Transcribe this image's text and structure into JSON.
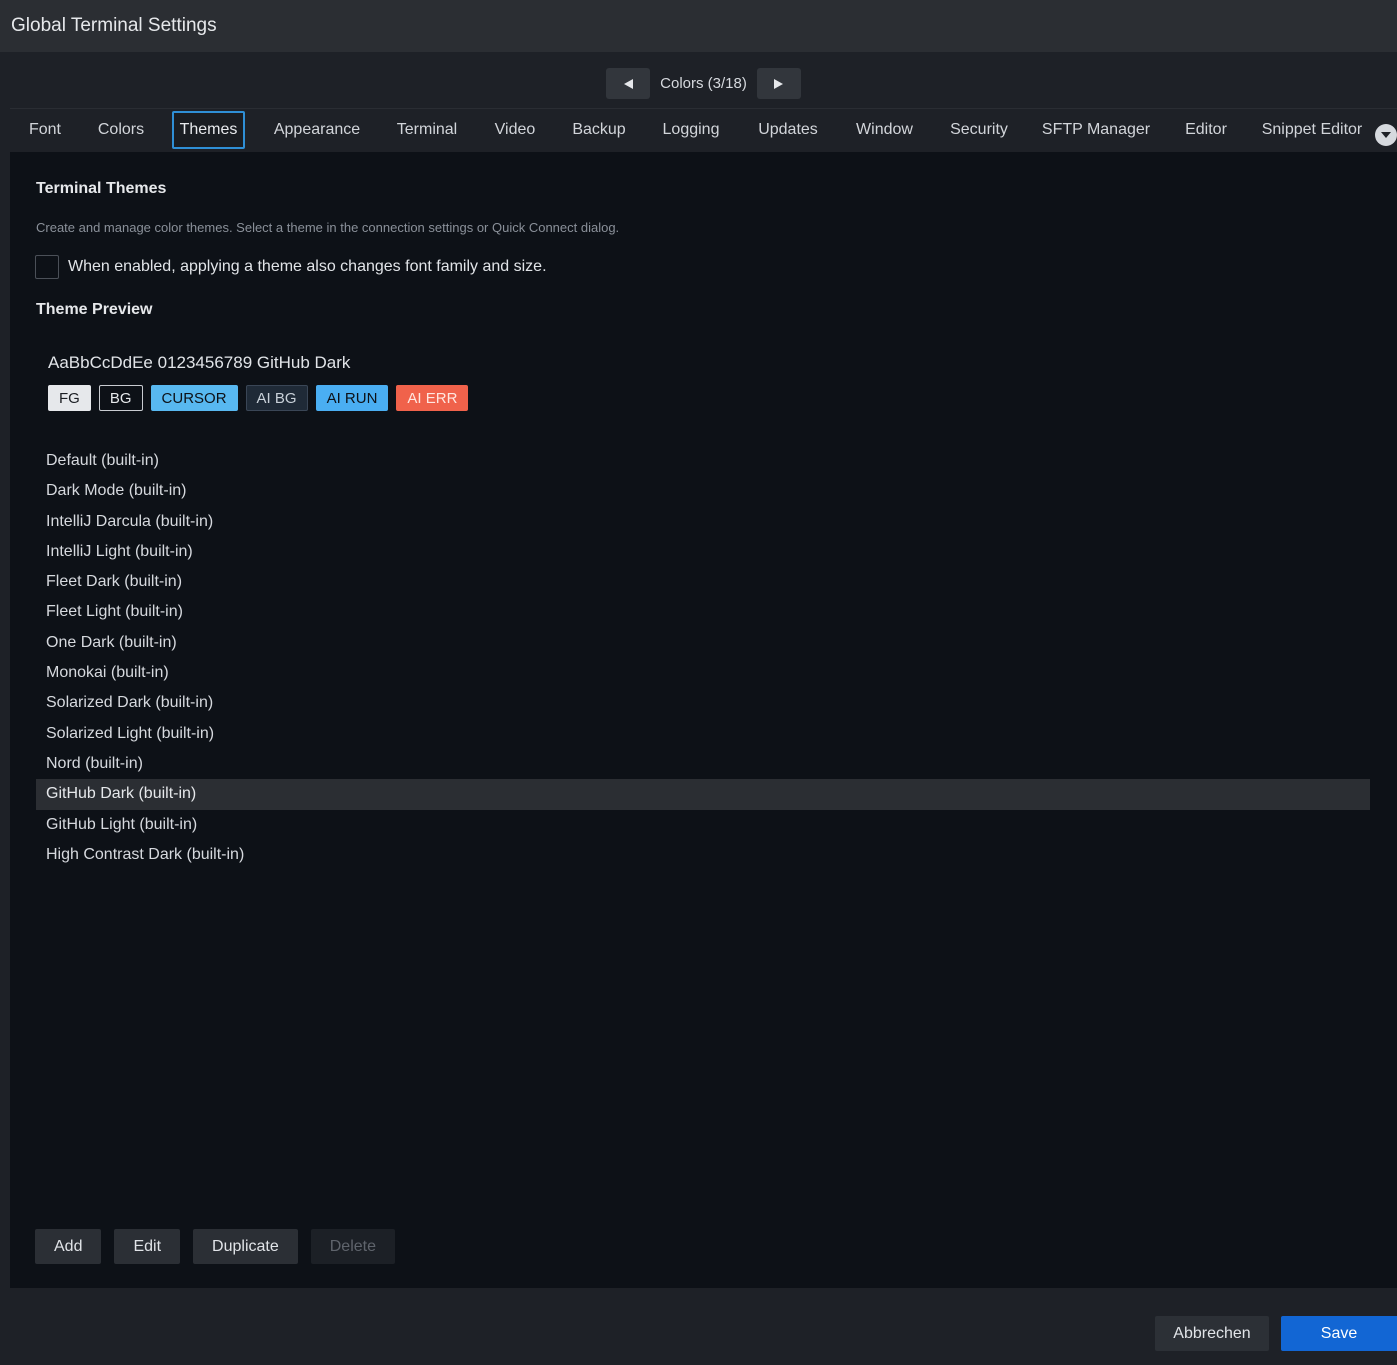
{
  "window": {
    "title": "Global Terminal Settings"
  },
  "pager": {
    "label": "Colors  (3/18)",
    "prev_icon": "triangle-left-icon",
    "next_icon": "triangle-right-icon"
  },
  "tabs": [
    {
      "label": "Font"
    },
    {
      "label": "Colors"
    },
    {
      "label": "Themes",
      "active": true
    },
    {
      "label": "Appearance"
    },
    {
      "label": "Terminal"
    },
    {
      "label": "Video"
    },
    {
      "label": "Backup"
    },
    {
      "label": "Logging"
    },
    {
      "label": "Updates"
    },
    {
      "label": "Window"
    },
    {
      "label": "Security"
    },
    {
      "label": "SFTP Manager"
    },
    {
      "label": "Editor"
    },
    {
      "label": "Snippet Editor"
    }
  ],
  "themes_page": {
    "title": "Terminal Themes",
    "description": "Create and manage color themes. Select a theme in the connection settings or Quick Connect dialog.",
    "font_checkbox": {
      "label": "When enabled, applying a theme also changes font family and size.",
      "checked": false
    },
    "preview": {
      "title": "Theme Preview",
      "sample_text": "AaBbCcDdEe 0123456789  GitHub Dark",
      "chips": [
        {
          "label": "FG",
          "bg": "#e6e8eb",
          "fg": "#1b1e23",
          "border": "#e6e8eb"
        },
        {
          "label": "BG",
          "bg": "#0d1117",
          "fg": "#e6e8eb",
          "border": "#c9ccd1"
        },
        {
          "label": "CURSOR",
          "bg": "#58b8f0",
          "fg": "#0d1117",
          "border": "#58b8f0"
        },
        {
          "label": "AI BG",
          "bg": "#1f2a37",
          "fg": "#c9d1d9",
          "border": "#3a4656"
        },
        {
          "label": "AI RUN",
          "bg": "#4aaef2",
          "fg": "#0d1117",
          "border": "#4aaef2"
        },
        {
          "label": "AI ERR",
          "bg": "#f0624b",
          "fg": "#ffe6e0",
          "border": "#f0624b"
        }
      ]
    },
    "themes": [
      {
        "label": "Default (built-in)"
      },
      {
        "label": "Dark Mode (built-in)"
      },
      {
        "label": "IntelliJ Darcula (built-in)"
      },
      {
        "label": "IntelliJ Light (built-in)"
      },
      {
        "label": "Fleet Dark (built-in)"
      },
      {
        "label": "Fleet Light (built-in)"
      },
      {
        "label": "One Dark (built-in)"
      },
      {
        "label": "Monokai (built-in)"
      },
      {
        "label": "Solarized Dark (built-in)"
      },
      {
        "label": "Solarized Light (built-in)"
      },
      {
        "label": "Nord (built-in)"
      },
      {
        "label": "GitHub Dark (built-in)",
        "selected": true
      },
      {
        "label": "GitHub Light (built-in)"
      },
      {
        "label": "High Contrast Dark (built-in)"
      }
    ],
    "actions": {
      "add": "Add",
      "edit": "Edit",
      "duplicate": "Duplicate",
      "delete": "Delete"
    }
  },
  "footer": {
    "cancel": "Abbrechen",
    "save": "Save"
  },
  "colors": {
    "accent": "#1266d4",
    "active_tab_border": "#2f8fd6",
    "content_bg": "#0d1117"
  }
}
